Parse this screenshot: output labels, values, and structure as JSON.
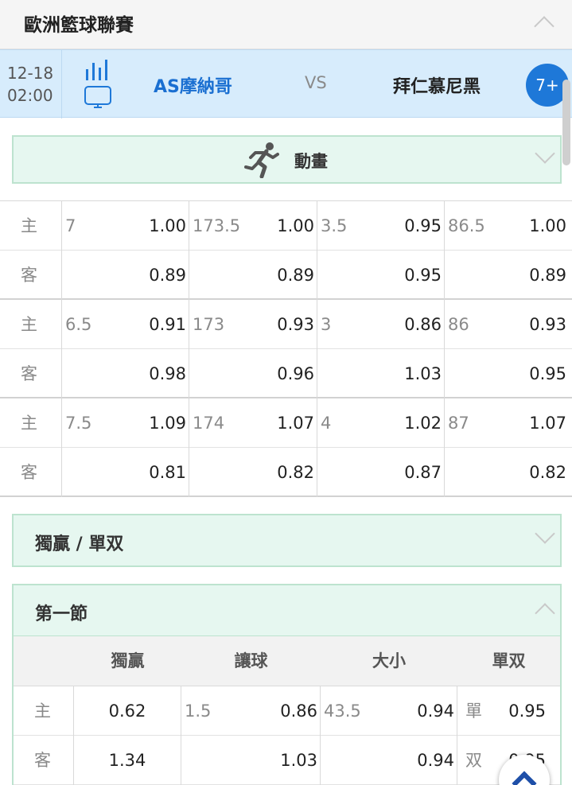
{
  "league": {
    "title": "歐洲籃球聯賽"
  },
  "match": {
    "date": "12-18",
    "time": "02:00",
    "home": "AS摩納哥",
    "vs": "VS",
    "away": "拜仁慕尼黑",
    "more": "7+"
  },
  "animation": {
    "label": "動畫"
  },
  "odds_groups": [
    {
      "home_label": "主",
      "away_label": "客",
      "home": [
        [
          "7",
          "1.00"
        ],
        [
          "173.5",
          "1.00"
        ],
        [
          "3.5",
          "0.95"
        ],
        [
          "86.5",
          "1.00"
        ]
      ],
      "away": [
        [
          "",
          "0.89"
        ],
        [
          "",
          "0.89"
        ],
        [
          "",
          "0.95"
        ],
        [
          "",
          "0.89"
        ]
      ]
    },
    {
      "home_label": "主",
      "away_label": "客",
      "home": [
        [
          "6.5",
          "0.91"
        ],
        [
          "173",
          "0.93"
        ],
        [
          "3",
          "0.86"
        ],
        [
          "86",
          "0.93"
        ]
      ],
      "away": [
        [
          "",
          "0.98"
        ],
        [
          "",
          "0.96"
        ],
        [
          "",
          "1.03"
        ],
        [
          "",
          "0.95"
        ]
      ]
    },
    {
      "home_label": "主",
      "away_label": "客",
      "home": [
        [
          "7.5",
          "1.09"
        ],
        [
          "174",
          "1.07"
        ],
        [
          "4",
          "1.02"
        ],
        [
          "87",
          "1.07"
        ]
      ],
      "away": [
        [
          "",
          "0.81"
        ],
        [
          "",
          "0.82"
        ],
        [
          "",
          "0.87"
        ],
        [
          "",
          "0.82"
        ]
      ]
    }
  ],
  "moneyline_panel": {
    "title": "獨贏 / 單双"
  },
  "first_quarter": {
    "title": "第一節",
    "columns": [
      "獨贏",
      "讓球",
      "大小",
      "單双"
    ],
    "rows": [
      {
        "side": "主",
        "ml": "0.62",
        "hcp_line": "1.5",
        "hcp": "0.86",
        "ou_line": "43.5",
        "ou": "0.94",
        "oe_label": "單",
        "oe": "0.95"
      },
      {
        "side": "客",
        "ml": "1.34",
        "hcp_line": "",
        "hcp": "1.03",
        "ou_line": "",
        "ou": "0.94",
        "oe_label": "双",
        "oe": "0.95"
      }
    ]
  },
  "icons": [
    "chevron-up-icon",
    "stats-icon",
    "tv-icon",
    "runner-icon",
    "chevron-down-icon",
    "back-to-top-icon"
  ],
  "colors": {
    "accent_blue": "#1e78d8",
    "team_blue": "#1a6fd1",
    "match_bg": "#d7ecfc",
    "panel_bg": "#e6f7f0",
    "panel_border": "#bde3cf"
  }
}
